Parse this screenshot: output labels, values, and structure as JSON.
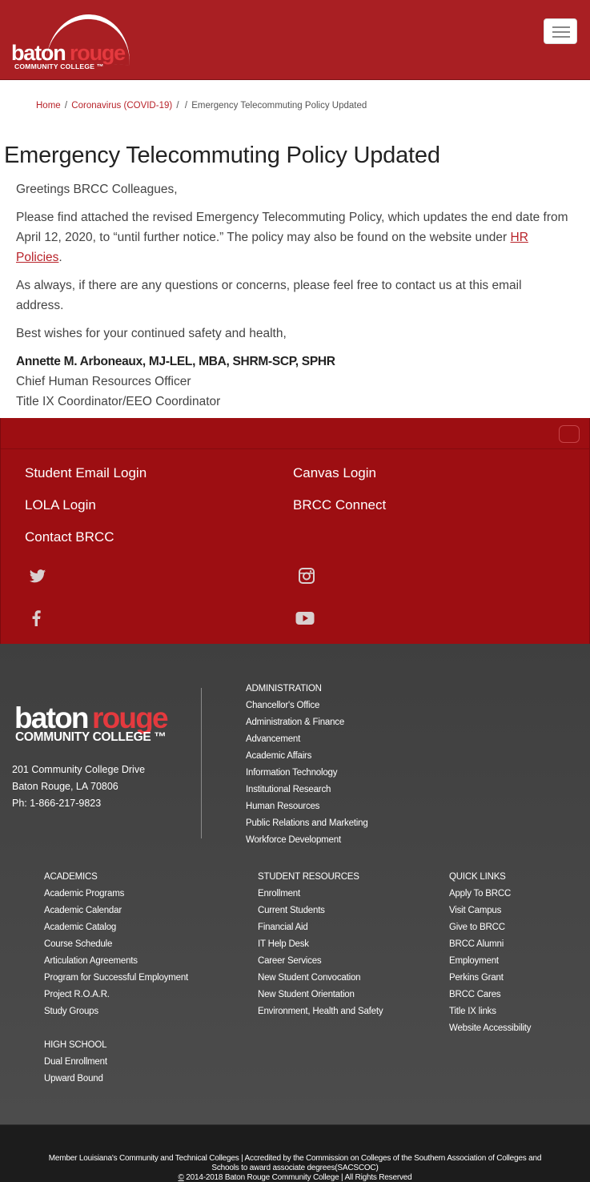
{
  "header": {
    "logo": {
      "word_white": "baton",
      "word_red": "rouge",
      "subline": "COMMUNITY COLLEGE ™"
    },
    "menu_icon": "hamburger-icon"
  },
  "breadcrumb": {
    "home": "Home",
    "section": "Coronavirus (COVID-19)",
    "separator1": "/",
    "separator2": "/",
    "separator3": "/",
    "current": "Emergency Telecommuting Policy Updated"
  },
  "article": {
    "title": "Emergency Telecommuting Policy Updated",
    "greeting": "Greetings BRCC Colleagues,",
    "p1_before_link": "Please find attached the revised Emergency Telecommuting Policy, which updates the end date from April 12, 2020, to “until further notice.”  The policy may also be found on the website under ",
    "p1_link": "HR Policies",
    "p1_after_link": ".",
    "p2": "As always, if there are any questions or concerns, please feel free to contact us at this email address.",
    "p3": "Best wishes for your continued safety and health,",
    "signature_name": "Annette M. Arboneaux, MJ-LEL, MBA, SHRM-SCP, SPHR",
    "signature_title1": "Chief Human Resources Officer",
    "signature_title2": "Title IX Coordinator/EEO Coordinator"
  },
  "quick_band": {
    "student_email": "Student Email Login",
    "canvas": "Canvas Login",
    "lola": "LOLA Login",
    "brcc_connect": "BRCC Connect",
    "contact": "Contact BRCC",
    "icons": [
      "twitter-icon",
      "instagram-icon",
      "facebook-icon",
      "youtube-icon"
    ]
  },
  "footer": {
    "logo": {
      "word_white": "baton",
      "word_red": "rouge",
      "subline": "COMMUNITY COLLEGE ™"
    },
    "address_line1": "201 Community College Drive",
    "address_line2": "Baton Rouge, LA 70806",
    "phone": "Ph: 1-866-217-9823",
    "administration": {
      "heading": "ADMINISTRATION",
      "items": [
        "Chancellor's Office",
        "Administration & Finance",
        "Advancement",
        "Academic Affairs",
        "Information Technology",
        "Institutional Research",
        "Human Resources",
        "Public Relations and Marketing",
        "Workforce Development"
      ]
    },
    "academics": {
      "heading": "ACADEMICS",
      "items": [
        "Academic Programs",
        "Academic Calendar",
        "Academic Catalog",
        "Course Schedule",
        "Articulation Agreements",
        "Program for Successful Employment",
        "Project R.O.A.R.",
        "Study Groups"
      ]
    },
    "high_school": {
      "heading": "HIGH SCHOOL",
      "items": [
        "Dual Enrollment",
        "Upward Bound"
      ]
    },
    "student_resources": {
      "heading": "STUDENT RESOURCES",
      "items": [
        "Enrollment",
        "Current Students",
        "Financial Aid",
        "IT Help Desk",
        "Career Services",
        "New Student Convocation",
        "New Student Orientation",
        "Environment, Health and Safety"
      ]
    },
    "quick_links": {
      "heading": "QUICK LINKS",
      "items": [
        "Apply To BRCC",
        "Visit Campus",
        "Give to BRCC",
        "BRCC Alumni",
        "Employment",
        "Perkins Grant",
        "BRCC Cares",
        "Title IX links",
        "Website Accessibility"
      ]
    }
  },
  "bottom": {
    "line1": "Member Louisiana's Community and Technical Colleges  | Accredited by the Commission on Colleges of the Southern Association of Colleges and",
    "line2": "Schools to award associate degrees(SACSCOC)",
    "copyright_symbol": "©",
    "line3": " 2014-2018 Baton Rouge Community College  |  All Rights Reserved"
  }
}
